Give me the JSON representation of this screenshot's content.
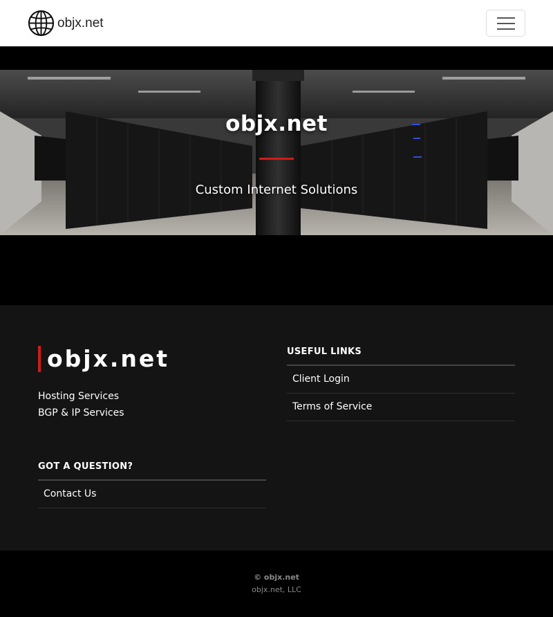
{
  "navbar": {
    "brand": "objx.net",
    "logo_icon": "globe-icon",
    "menu_icon": "hamburger-menu-icon"
  },
  "hero": {
    "title": "objx.net",
    "subtitle": "Custom Internet Solutions",
    "accent_color": "#d11b1b"
  },
  "footer": {
    "logo_text": "objx.net",
    "services": [
      "Hosting Services",
      "BGP & IP Services"
    ],
    "useful_links": {
      "heading": "USEFUL LINKS",
      "items": [
        "Client Login",
        "Terms of Service"
      ]
    },
    "question": {
      "heading": "GOT A QUESTION?",
      "items": [
        "Contact Us"
      ]
    },
    "copyright": "© objx.net",
    "company": "objx.net, LLC"
  },
  "colors": {
    "accent": "#d11b1b",
    "footer_bg": "#141414",
    "page_bg": "#000000"
  }
}
